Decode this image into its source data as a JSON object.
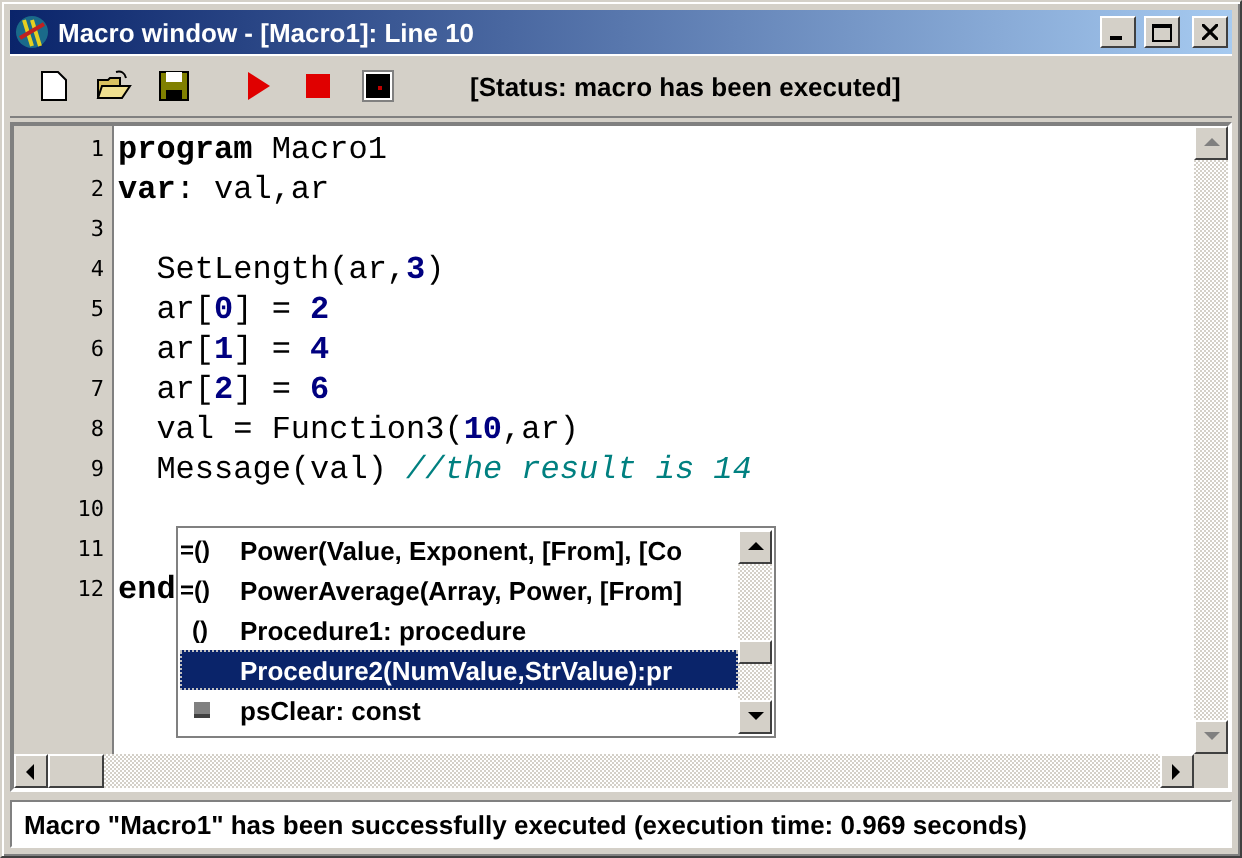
{
  "window": {
    "title": "Macro window - [Macro1]: Line 10"
  },
  "toolbar": {
    "status": "[Status: macro has been executed]"
  },
  "editor": {
    "lines": [
      {
        "number": "1",
        "tokens": [
          {
            "kind": "keyword",
            "text": "program"
          },
          {
            "kind": "plain",
            "text": " Macro1"
          }
        ]
      },
      {
        "number": "2",
        "tokens": [
          {
            "kind": "keyword",
            "text": "var"
          },
          {
            "kind": "plain",
            "text": ": val,ar"
          }
        ]
      },
      {
        "number": "3"
      },
      {
        "number": "4",
        "tokens": [
          {
            "kind": "plain",
            "text": "  SetLength(ar,"
          },
          {
            "kind": "number",
            "text": "3"
          },
          {
            "kind": "plain",
            "text": ")"
          }
        ]
      },
      {
        "number": "5",
        "tokens": [
          {
            "kind": "plain",
            "text": "  ar["
          },
          {
            "kind": "number",
            "text": "0"
          },
          {
            "kind": "plain",
            "text": "] = "
          },
          {
            "kind": "number",
            "text": "2"
          }
        ]
      },
      {
        "number": "6",
        "tokens": [
          {
            "kind": "plain",
            "text": "  ar["
          },
          {
            "kind": "number",
            "text": "1"
          },
          {
            "kind": "plain",
            "text": "] = "
          },
          {
            "kind": "number",
            "text": "4"
          }
        ]
      },
      {
        "number": "7",
        "tokens": [
          {
            "kind": "plain",
            "text": "  ar["
          },
          {
            "kind": "number",
            "text": "2"
          },
          {
            "kind": "plain",
            "text": "] = "
          },
          {
            "kind": "number",
            "text": "6"
          }
        ]
      },
      {
        "number": "8",
        "tokens": [
          {
            "kind": "plain",
            "text": "  val = Function3("
          },
          {
            "kind": "number",
            "text": "10"
          },
          {
            "kind": "plain",
            "text": ",ar)"
          }
        ]
      },
      {
        "number": "9",
        "tokens": [
          {
            "kind": "plain",
            "text": "  Message(val) "
          },
          {
            "kind": "comment",
            "text": "//the result is 14"
          }
        ]
      },
      {
        "number": "10"
      },
      {
        "number": "11"
      },
      {
        "number": "12",
        "tokens": [
          {
            "kind": "keyword",
            "text": "end"
          }
        ]
      }
    ]
  },
  "completion": {
    "items": [
      {
        "kind": "function",
        "glyph": "=()",
        "label": "Power(Value, Exponent, [From], [Co",
        "selected": false
      },
      {
        "kind": "function",
        "glyph": "=()",
        "label": "PowerAverage(Array, Power, [From]",
        "selected": false
      },
      {
        "kind": "procedure",
        "glyph": "()",
        "label": "Procedure1: procedure",
        "selected": false
      },
      {
        "kind": "plain",
        "label": "Procedure2(NumValue,StrValue):pr",
        "selected": true
      },
      {
        "kind": "const",
        "label": "psClear: const",
        "selected": false
      }
    ]
  },
  "status_bar": {
    "text": "Macro \"Macro1\" has been successfully executed (execution time: 0.969 seconds)"
  }
}
